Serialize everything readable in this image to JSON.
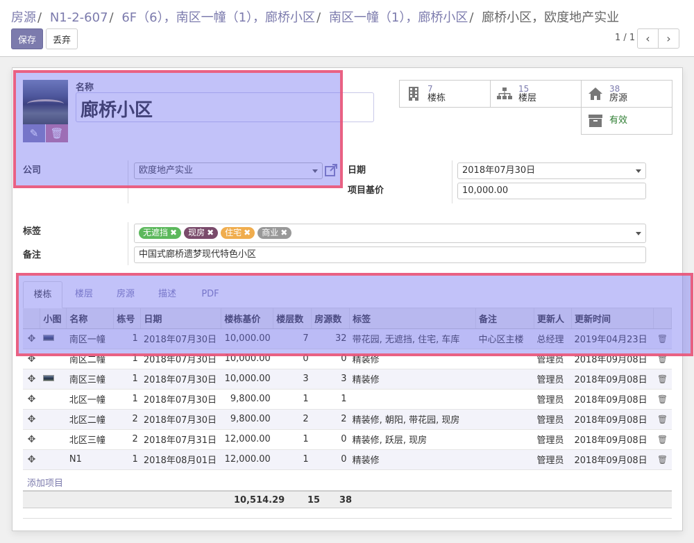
{
  "breadcrumb": [
    "房源",
    "N1-2-607",
    "6F（6），南区一幢（1），廊桥小区",
    "南区一幢（1），廊桥小区"
  ],
  "breadcrumb_active": "廊桥小区，欧度地产实业",
  "buttons": {
    "save": "保存",
    "discard": "丢弃"
  },
  "pager": {
    "value": "1 / 1",
    "prev": "‹",
    "next": "›"
  },
  "form": {
    "name_label": "名称",
    "name": "廊桥小区",
    "company_label": "公司",
    "company": "欧度地产实业",
    "date_label": "日期",
    "date": "2018年07月30日",
    "base_price_label": "项目基价",
    "base_price": "10,000.00",
    "tags_label": "标签",
    "tags": [
      {
        "label": "无遮挡",
        "color": "#5cb85c"
      },
      {
        "label": "现房",
        "color": "#7a4b6b"
      },
      {
        "label": "住宅",
        "color": "#f0ad4e"
      },
      {
        "label": "商业",
        "color": "#999999"
      }
    ],
    "note_label": "备注",
    "note": "中国式廊桥遗梦现代特色小区"
  },
  "stats": [
    {
      "num": "7",
      "label": "楼栋",
      "icon": "building-icon"
    },
    {
      "num": "15",
      "label": "楼层",
      "icon": "sitemap-icon"
    },
    {
      "num": "38",
      "label": "房源",
      "icon": "home-icon"
    },
    {
      "num": "",
      "label": "有效",
      "icon": "archive-icon"
    }
  ],
  "tabs": [
    "楼栋",
    "楼层",
    "房源",
    "描述",
    "PDF"
  ],
  "table": {
    "columns": [
      "",
      "小图",
      "名称",
      "栋号",
      "日期",
      "楼栋基价",
      "楼层数",
      "房源数",
      "标签",
      "备注",
      "更新人",
      "更新时间",
      ""
    ],
    "rows": [
      {
        "thumb": true,
        "name": "南区一幢",
        "no": "1",
        "date": "2018年07月30日",
        "price": "10,000.00",
        "floors": "7",
        "rooms": "32",
        "tags": "带花园, 无遮挡, 住宅, 车库",
        "note": "中心区主楼",
        "user": "总经理",
        "updated": "2019年04月23日"
      },
      {
        "thumb": false,
        "name": "南区二幢",
        "no": "1",
        "date": "2018年07月30日",
        "price": "10,000.00",
        "floors": "0",
        "rooms": "0",
        "tags": "精装修",
        "note": "",
        "user": "管理员",
        "updated": "2018年09月08日"
      },
      {
        "thumb": true,
        "name": "南区三幢",
        "no": "1",
        "date": "2018年07月30日",
        "price": "10,000.00",
        "floors": "3",
        "rooms": "3",
        "tags": "精装修",
        "note": "",
        "user": "管理员",
        "updated": "2018年09月08日"
      },
      {
        "thumb": false,
        "name": "北区一幢",
        "no": "1",
        "date": "2018年07月30日",
        "price": "9,800.00",
        "floors": "1",
        "rooms": "1",
        "tags": "",
        "note": "",
        "user": "管理员",
        "updated": "2018年09月08日"
      },
      {
        "thumb": false,
        "name": "北区二幢",
        "no": "2",
        "date": "2018年07月30日",
        "price": "9,800.00",
        "floors": "2",
        "rooms": "2",
        "tags": "精装修, 朝阳, 带花园, 现房",
        "note": "",
        "user": "管理员",
        "updated": "2018年09月08日"
      },
      {
        "thumb": false,
        "name": "北区三幢",
        "no": "2",
        "date": "2018年07月31日",
        "price": "12,000.00",
        "floors": "1",
        "rooms": "0",
        "tags": "精装修, 跃层, 现房",
        "note": "",
        "user": "管理员",
        "updated": "2018年09月08日"
      },
      {
        "thumb": false,
        "name": "N1",
        "no": "1",
        "date": "2018年08月01日",
        "price": "12,000.00",
        "floors": "1",
        "rooms": "0",
        "tags": "精装修",
        "note": "",
        "user": "管理员",
        "updated": "2018年09月08日"
      }
    ],
    "add_line": "添加项目",
    "totals": {
      "price": "10,514.29",
      "floors": "15",
      "rooms": "38"
    }
  },
  "colors": {
    "accent": "#7c7bad",
    "highlight_fill": "#6e6ef0",
    "highlight_border": "#f0506e"
  }
}
